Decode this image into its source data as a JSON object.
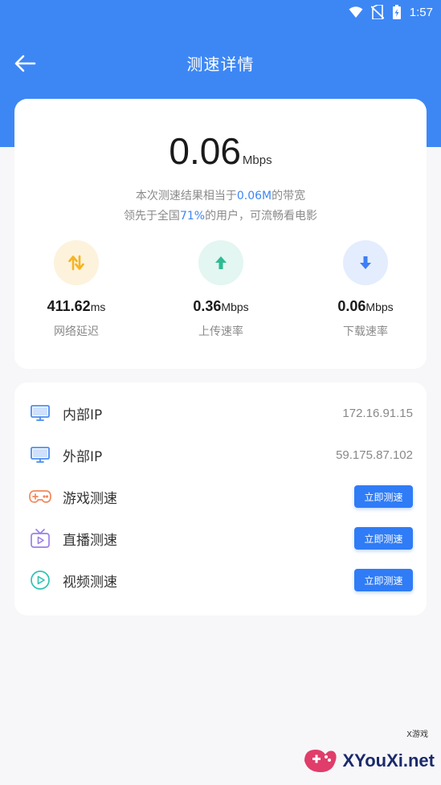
{
  "status_bar": {
    "time": "1:57"
  },
  "header": {
    "title": "测速详情"
  },
  "summary": {
    "speed_value": "0.06",
    "speed_unit": "Mbps",
    "desc1_pre": "本次测速结果相当于",
    "desc1_hl": "0.06M",
    "desc1_post": "的带宽",
    "desc2_pre": "领先于全国",
    "desc2_hl": "71%",
    "desc2_post": "的用户，可流畅看电影",
    "metrics": [
      {
        "value": "411.62",
        "unit": "ms",
        "label": "网络延迟",
        "icon": "latency-arrows-icon",
        "bg": "#fdf2db",
        "color": "#f5b523"
      },
      {
        "value": "0.36",
        "unit": "Mbps",
        "label": "上传速率",
        "icon": "upload-arrow-icon",
        "bg": "#e3f6f1",
        "color": "#2dbb94"
      },
      {
        "value": "0.06",
        "unit": "Mbps",
        "label": "下载速率",
        "icon": "download-arrow-icon",
        "bg": "#e4edfd",
        "color": "#3d7ef4"
      }
    ]
  },
  "list": {
    "internal_ip": {
      "label": "内部IP",
      "value": "172.16.91.15",
      "icon": "monitor-icon"
    },
    "external_ip": {
      "label": "外部IP",
      "value": "59.175.87.102",
      "icon": "monitor-icon"
    },
    "game": {
      "label": "游戏测速",
      "button": "立即测速",
      "icon": "gamepad-icon"
    },
    "live": {
      "label": "直播测速",
      "button": "立即测速",
      "icon": "tv-icon"
    },
    "video": {
      "label": "视频测速",
      "button": "立即测速",
      "icon": "play-circle-icon"
    }
  },
  "watermark": {
    "brand": "XYouXi.net",
    "tag": "X游戏"
  },
  "colors": {
    "primary": "#3d87f5",
    "button": "#2f7cf6"
  }
}
